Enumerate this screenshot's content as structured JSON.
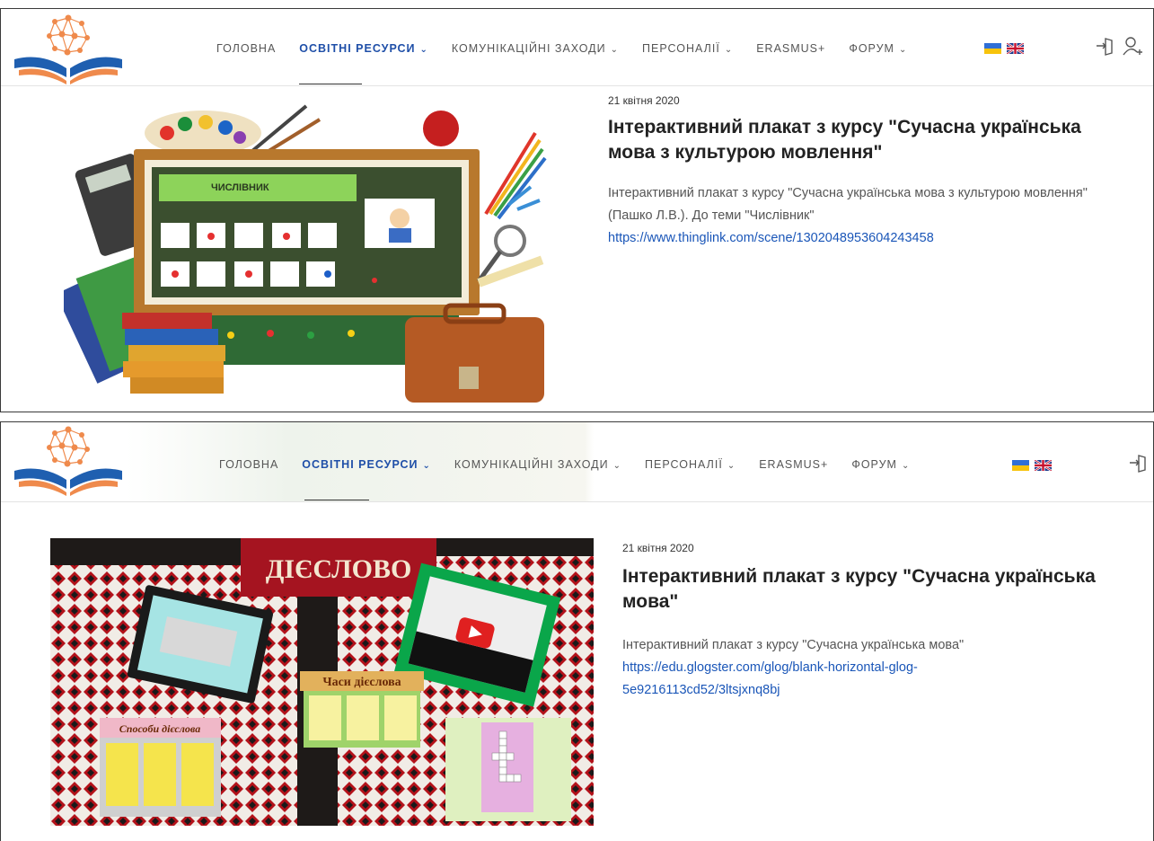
{
  "nav": {
    "items": [
      {
        "label": "ГОЛОВНА",
        "dropdown": false,
        "active": false
      },
      {
        "label": "ОСВІТНІ РЕСУРСИ",
        "dropdown": true,
        "active": true
      },
      {
        "label": "КОМУНІКАЦІЙНІ ЗАХОДИ",
        "dropdown": true,
        "active": false
      },
      {
        "label": "ПЕРСОНАЛІЇ",
        "dropdown": true,
        "active": false
      },
      {
        "label": "ERASMUS+",
        "dropdown": false,
        "active": false
      },
      {
        "label": "ФОРУМ",
        "dropdown": true,
        "active": false
      }
    ],
    "active_color": "#1f4fa8"
  },
  "posts": [
    {
      "date": "21 квітня 2020",
      "title": "Інтерактивний плакат з курсу \"Сучасна українська мова з культурою мовлення\"",
      "excerpt_text": "Інтерактивний плакат з курсу \"Сучасна українська мова з культурою мовлення\" (Пашко Л.В.). До теми \"Числівник\" ",
      "link": "https://www.thinglink.com/scene/1302048953604243458",
      "image_text": "ЧИСЛІВНИК"
    },
    {
      "date": "21 квітня 2020",
      "title": "Інтерактивний плакат з курсу \"Сучасна українська мова\"",
      "excerpt_text": " Інтерактивний плакат з курсу \"Сучасна українська мова\" ",
      "link": "https://edu.glogster.com/glog/blank-horizontal-glog-5e9216113cd52/3ltsjxnq8bj",
      "image_title": "ДІЄСЛОВО",
      "image_sub1": "Часи  дієслова",
      "image_sub2": "Способи дієслова"
    }
  ],
  "icons": [
    "login-icon",
    "user-add-icon",
    "flag-ukraine-icon",
    "flag-uk-icon"
  ]
}
